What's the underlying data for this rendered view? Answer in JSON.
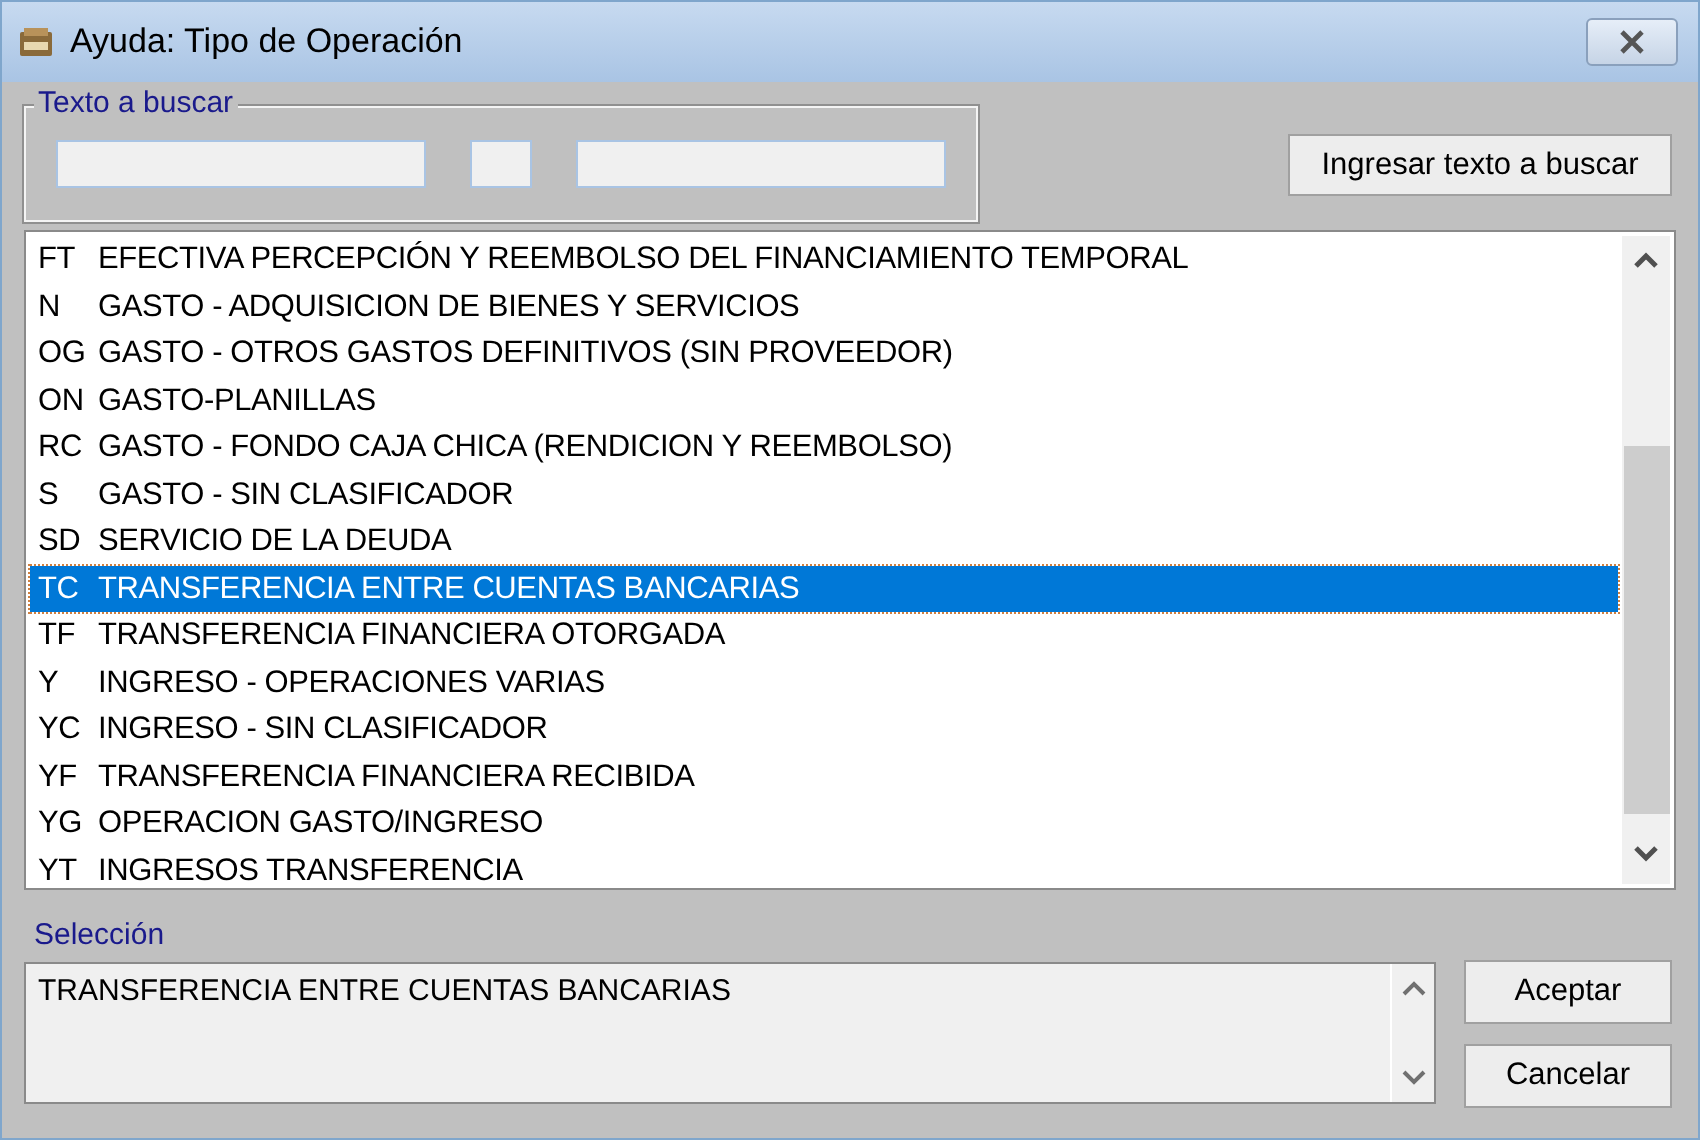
{
  "window": {
    "title": "Ayuda: Tipo de Operación"
  },
  "search": {
    "legend": "Texto a buscar",
    "button": "Ingresar texto a buscar"
  },
  "list": {
    "rows": [
      {
        "code": "FT",
        "text": "EFECTIVA PERCEPCIÓN Y REEMBOLSO DEL FINANCIAMIENTO TEMPORAL",
        "selected": false
      },
      {
        "code": "N",
        "text": "GASTO - ADQUISICION DE BIENES Y SERVICIOS",
        "selected": false
      },
      {
        "code": "OG",
        "text": "GASTO - OTROS GASTOS DEFINITIVOS (SIN PROVEEDOR)",
        "selected": false
      },
      {
        "code": "ON",
        "text": "GASTO-PLANILLAS",
        "selected": false
      },
      {
        "code": "RC",
        "text": "GASTO - FONDO CAJA CHICA (RENDICION Y REEMBOLSO)",
        "selected": false
      },
      {
        "code": "S",
        "text": "GASTO - SIN CLASIFICADOR",
        "selected": false
      },
      {
        "code": "SD",
        "text": "SERVICIO DE LA DEUDA",
        "selected": false
      },
      {
        "code": "TC",
        "text": "TRANSFERENCIA ENTRE CUENTAS BANCARIAS",
        "selected": true
      },
      {
        "code": "TF",
        "text": "TRANSFERENCIA FINANCIERA OTORGADA",
        "selected": false
      },
      {
        "code": "Y",
        "text": "INGRESO - OPERACIONES VARIAS",
        "selected": false
      },
      {
        "code": "YC",
        "text": "INGRESO - SIN CLASIFICADOR",
        "selected": false
      },
      {
        "code": "YF",
        "text": "TRANSFERENCIA FINANCIERA RECIBIDA",
        "selected": false
      },
      {
        "code": "YG",
        "text": "OPERACION GASTO/INGRESO",
        "selected": false
      },
      {
        "code": "YT",
        "text": "INGRESOS TRANSFERENCIA",
        "selected": false
      }
    ]
  },
  "selection": {
    "label": "Selección",
    "value": "TRANSFERENCIA ENTRE CUENTAS BANCARIAS"
  },
  "buttons": [
    "Aceptar",
    "Cancelar"
  ]
}
